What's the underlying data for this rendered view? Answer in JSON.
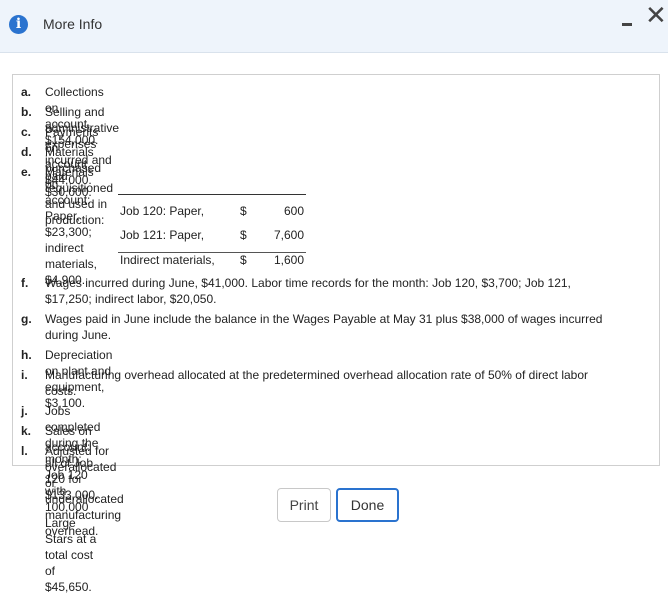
{
  "header": {
    "title": "More Info",
    "info_icon": "i",
    "minimize_icon": "minimize-icon",
    "close_icon": "close-icon"
  },
  "items": [
    {
      "label": "a.",
      "text": "Collections on account, $154,000."
    },
    {
      "label": "b.",
      "text": "Selling and administrative expenses incurred and paid, $30,000."
    },
    {
      "label": "c.",
      "text": "Payments on account, $44,000."
    },
    {
      "label": "d.",
      "text": "Materials purchased on account: Paper, $23,300; indirect materials, $4,900."
    },
    {
      "label": "e.",
      "text": "Materials requisitioned and used in production:"
    },
    {
      "label": "f.",
      "line1": "Wages incurred during June, $41,000. Labor time records for the month: Job 120, $3,700; Job 121,",
      "line2": "$17,250; indirect labor, $20,050."
    },
    {
      "label": "g.",
      "line1": "Wages paid in June include the balance in the Wages Payable at May 31 plus $38,000 of wages incurred",
      "line2": "during June."
    },
    {
      "label": "h.",
      "text": "Depreciation on plant and equipment, $3,100."
    },
    {
      "label": "i.",
      "line1": "Manufacturing overhead allocated at the predetermined overhead allocation rate of 50% of direct labor",
      "line2": "costs."
    },
    {
      "label": "j.",
      "text": "Jobs completed during the month: Job 120 with 100,000 Large Stars at a total cost of $45,650."
    },
    {
      "label": "k.",
      "text": "Sales on account: all of Job 120 for $133,000."
    },
    {
      "label": "l.",
      "text": "Adjusted for overallocated or underallocated manufacturing overhead."
    }
  ],
  "materials_table": [
    {
      "name": "Job 120: Paper,",
      "currency": "$",
      "amount": "600"
    },
    {
      "name": "Job 121: Paper,",
      "currency": "$",
      "amount": "7,600"
    },
    {
      "name": "Indirect materials,",
      "currency": "$",
      "amount": "1,600"
    }
  ],
  "buttons": {
    "print": "Print",
    "done": "Done"
  },
  "colors": {
    "header_bg": "#eef4fb",
    "accent": "#2a73cf"
  }
}
